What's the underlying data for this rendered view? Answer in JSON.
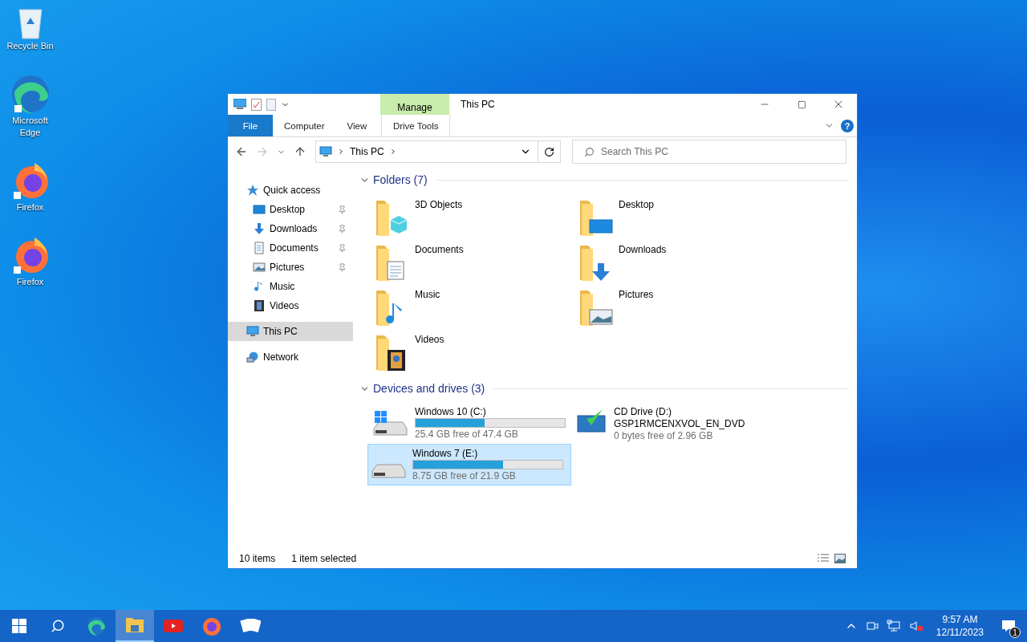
{
  "desktop_icons": [
    {
      "label": "Recycle Bin",
      "kind": "recycle"
    },
    {
      "label": "Microsoft Edge",
      "kind": "edge"
    },
    {
      "label": "Firefox",
      "kind": "firefox"
    },
    {
      "label": "Firefox",
      "kind": "firefox"
    }
  ],
  "window": {
    "title": "This PC",
    "ribbon_context": {
      "label": "Manage"
    },
    "help": "?",
    "ribbon_tabs": [
      {
        "label": "File",
        "kind": "file",
        "selected": false
      },
      {
        "label": "Computer",
        "kind": "tab",
        "selected": false
      },
      {
        "label": "View",
        "kind": "tab",
        "selected": false
      },
      {
        "label": "Drive Tools",
        "kind": "context",
        "selected": false
      }
    ],
    "address": {
      "path": "This PC"
    },
    "search": {
      "placeholder": "Search This PC"
    },
    "nav": [
      {
        "label": "Quick access",
        "kind": "star",
        "selected": false,
        "children": [
          {
            "label": "Desktop",
            "kind": "desktop",
            "pinned": true,
            "selected": false
          },
          {
            "label": "Downloads",
            "kind": "downloads",
            "pinned": true,
            "selected": false
          },
          {
            "label": "Documents",
            "kind": "documents",
            "pinned": true,
            "selected": false
          },
          {
            "label": "Pictures",
            "kind": "pictures",
            "pinned": true,
            "selected": false
          },
          {
            "label": "Music",
            "kind": "music",
            "pinned": false,
            "selected": false
          },
          {
            "label": "Videos",
            "kind": "videos",
            "pinned": false,
            "selected": false
          }
        ]
      },
      {
        "label": "This PC",
        "kind": "pc",
        "selected": true
      },
      {
        "label": "Network",
        "kind": "network",
        "selected": false
      }
    ],
    "sections": [
      {
        "title": "Folders (7)",
        "expanded": true,
        "items": [
          {
            "kind": "cube",
            "label": "3D Objects",
            "selected": false
          },
          {
            "kind": "desktop",
            "label": "Desktop",
            "selected": false
          },
          {
            "kind": "documents",
            "label": "Documents",
            "selected": false
          },
          {
            "kind": "downloads",
            "label": "Downloads",
            "selected": false
          },
          {
            "kind": "music",
            "label": "Music",
            "selected": false
          },
          {
            "kind": "pictures",
            "label": "Pictures",
            "selected": false
          },
          {
            "kind": "videos",
            "label": "Videos",
            "selected": false
          }
        ]
      },
      {
        "title": "Devices and drives (3)",
        "expanded": true,
        "items": [
          {
            "kind": "drive",
            "windows": true,
            "label": "Windows 10 (C:)",
            "level": 0.46,
            "free": "25.4 GB free of 47.4 GB",
            "selected": false
          },
          {
            "kind": "cd",
            "label": "CD Drive (D:)",
            "volume": "GSP1RMCENXVOL_EN_DVD",
            "free": "0 bytes free of 2.96 GB",
            "selected": false
          },
          {
            "kind": "drive",
            "windows": false,
            "label": "Windows 7 (E:)",
            "level": 0.6,
            "free": "8.75 GB free of 21.9 GB",
            "selected": true
          }
        ]
      }
    ],
    "status": {
      "count": "10 items",
      "selection": "1 item selected"
    }
  },
  "taskbar": {
    "apps": [
      {
        "kind": "edge",
        "selected": false
      },
      {
        "kind": "explorer",
        "selected": true
      },
      {
        "kind": "youtube",
        "selected": false
      },
      {
        "kind": "firefox",
        "selected": false
      },
      {
        "kind": "solitaire",
        "selected": false
      }
    ],
    "time": "9:57 AM",
    "date": "12/11/2023",
    "notifications": "1"
  }
}
